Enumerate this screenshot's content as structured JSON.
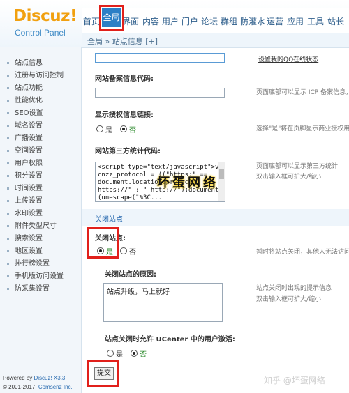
{
  "header": {
    "logo": "Discuz!",
    "logo_sub": "Control Panel",
    "nav": [
      "首页",
      "全局",
      "界面",
      "内容",
      "用户",
      "门户",
      "论坛",
      "群组",
      "防灌水",
      "运营",
      "应用",
      "工具",
      "站长"
    ],
    "active_nav": "全局",
    "breadcrumb": "全局 » 站点信息 [+]"
  },
  "sidebar": {
    "items": [
      "站点信息",
      "注册与访问控制",
      "站点功能",
      "性能优化",
      "SEO设置",
      "域名设置",
      "广播设置",
      "空间设置",
      "用户权限",
      "积分设置",
      "时间设置",
      "上传设置",
      "水印设置",
      "附件类型尺寸",
      "搜索设置",
      "地区设置",
      "排行榜设置",
      "手机版访问设置",
      "防采集设置"
    ],
    "footer_powered_prefix": "Powered by ",
    "footer_powered_version": "Discuz! X3.3",
    "footer_copy_prefix": "© 2001-2017, ",
    "footer_copy_company": "Comsenz Inc."
  },
  "form": {
    "qq_link": "设置我的QQ在线状态",
    "icp_label": "网站备案信息代码:",
    "icp_tip": "页面底部可以显示 ICP 备案信息，",
    "license_label": "显示授权信息链接:",
    "yes": "是",
    "no": "否",
    "license_tip": "选择\"是\"将在页脚显示商业授权用户",
    "stat_label": "网站第三方统计代码:",
    "stat_code": "<script type=\"text/javascript\">var\ncnzz_protocol = ((\"https:\" ==\ndocument.location.protocol) ? \"\nhttps://\" : \" http://\");document.write\n(unescape(\"%3C...",
    "stat_tip_1": "页面底部可以显示第三方统计",
    "stat_tip_2": "双击输入框可扩大/缩小",
    "section_title": "关闭站点",
    "close_label": "关闭站点:",
    "close_tip": "暂时将站点关闭，其他人无法访问",
    "reason_label": "关闭站点的原因:",
    "reason_value": "站点升级，马上就好",
    "reason_tip_1": "站点关闭时出现的提示信息",
    "reason_tip_2": "双击输入框可扩大/缩小",
    "ucenter_label": "站点关闭时允许 UCenter 中的用户激活:",
    "submit": "提交"
  },
  "watermarks": {
    "center": "坏蛋网络",
    "corner": "知乎 @坏蛋网络"
  },
  "colors": {
    "brand_orange": "#f1a00f",
    "nav_active": "#2b7fc6",
    "highlight_red": "#e1201b",
    "link_blue": "#2b6cb0"
  }
}
